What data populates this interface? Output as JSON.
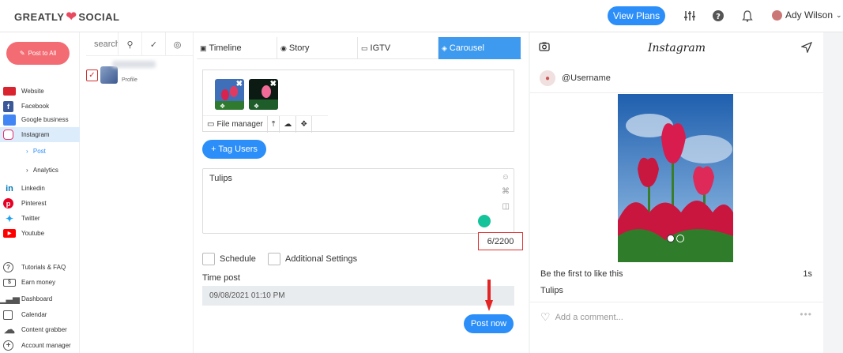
{
  "brand": {
    "logo_text_left": "GREATLY",
    "logo_text_right": "SOCIAL"
  },
  "topbar": {
    "view_plans": "View Plans",
    "user_name": "Ady Wilson"
  },
  "sidebar": {
    "post_all": "Post to All",
    "items": [
      {
        "label": "Website",
        "icon": "monitor-icon",
        "color": "#d9232e"
      },
      {
        "label": "Facebook",
        "icon": "facebook-icon",
        "color": "#3b5998"
      },
      {
        "label": "Google business",
        "icon": "store-icon",
        "color": "#4285f4"
      },
      {
        "label": "Instagram",
        "icon": "instagram-icon",
        "color": "#e1306c"
      },
      {
        "label": "Linkedin",
        "icon": "linkedin-icon",
        "color": "#0077b5"
      },
      {
        "label": "Pinterest",
        "icon": "pinterest-icon",
        "color": "#e60023"
      },
      {
        "label": "Twitter",
        "icon": "twitter-icon",
        "color": "#1da1f2"
      },
      {
        "label": "Youtube",
        "icon": "youtube-icon",
        "color": "#ff0000"
      },
      {
        "label": "Tutorials & FAQ",
        "icon": "help-icon",
        "color": "#555555"
      },
      {
        "label": "Earn money",
        "icon": "money-icon",
        "color": "#555555"
      },
      {
        "label": "Dashboard",
        "icon": "bar-chart-icon",
        "color": "#555555"
      },
      {
        "label": "Calendar",
        "icon": "calendar-icon",
        "color": "#555555"
      },
      {
        "label": "Content grabber",
        "icon": "cloud-icon",
        "color": "#555555"
      },
      {
        "label": "Account manager",
        "icon": "plus-circle-icon",
        "color": "#555555"
      }
    ],
    "sub_post": "Post",
    "sub_analytics": "Analytics"
  },
  "accounts": {
    "search_placeholder": "search",
    "account_type": "Profile"
  },
  "editor": {
    "tabs": [
      "Timeline",
      "Story",
      "IGTV",
      "Carousel"
    ],
    "media_tool_file_manager": "File manager",
    "tag_users": "+ Tag Users",
    "caption": "Tulips",
    "char_count": "6/2200",
    "schedule": "Schedule",
    "additional_settings": "Additional Settings",
    "time_post_label": "Time post",
    "time_post_value": "09/08/2021 01:10 PM",
    "post_now": "Post now"
  },
  "preview": {
    "title": "Instagram",
    "username": "@Username",
    "likes_text": "Be the first to like this",
    "time": "1s",
    "caption": "Tulips",
    "comment_placeholder": "Add a comment..."
  },
  "colors": {
    "accent": "#2c8ef8",
    "post_all": "#f36b73",
    "active_tab": "#3d9aef"
  }
}
